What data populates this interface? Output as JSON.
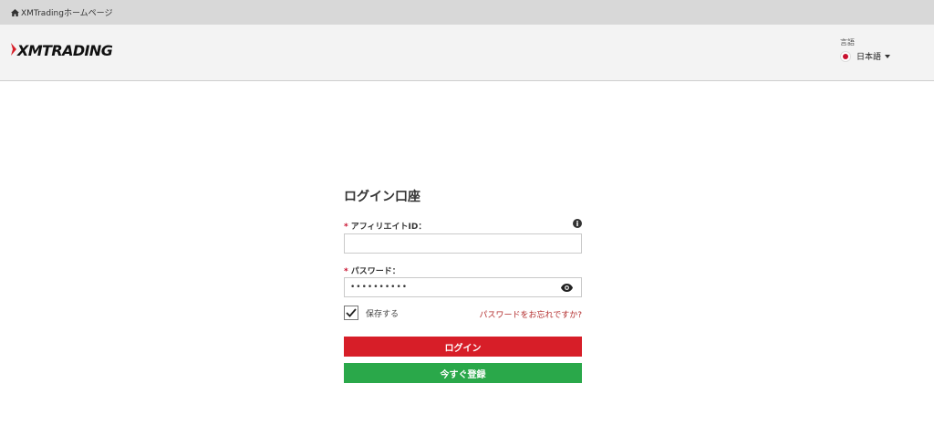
{
  "topbar": {
    "home_link": "XMTradingホームページ"
  },
  "header": {
    "logo_text": "XMTRADING",
    "language_label": "言語",
    "language_value": "日本語"
  },
  "form": {
    "title": "ログイン口座",
    "affiliate_label": "アフィリエイトID：",
    "affiliate_value": "",
    "password_label": "パスワード：",
    "password_value": "••••••••••",
    "required_mark": "*",
    "info_icon_glyph": "i",
    "remember_label": "保存する",
    "remember_checked": true,
    "forgot_link": "パスワードをお忘れですか?",
    "login_button": "ログイン",
    "register_button": "今すぐ登録"
  },
  "colors": {
    "login_button": "#d71e28",
    "register_button": "#2aa84a",
    "forgot_link": "#b22b2b",
    "required": "#c8102e"
  },
  "icons": [
    "home-icon",
    "logo-mark-icon",
    "japan-flag-icon",
    "chevron-down-icon",
    "info-icon",
    "eye-icon",
    "checkmark-icon"
  ]
}
